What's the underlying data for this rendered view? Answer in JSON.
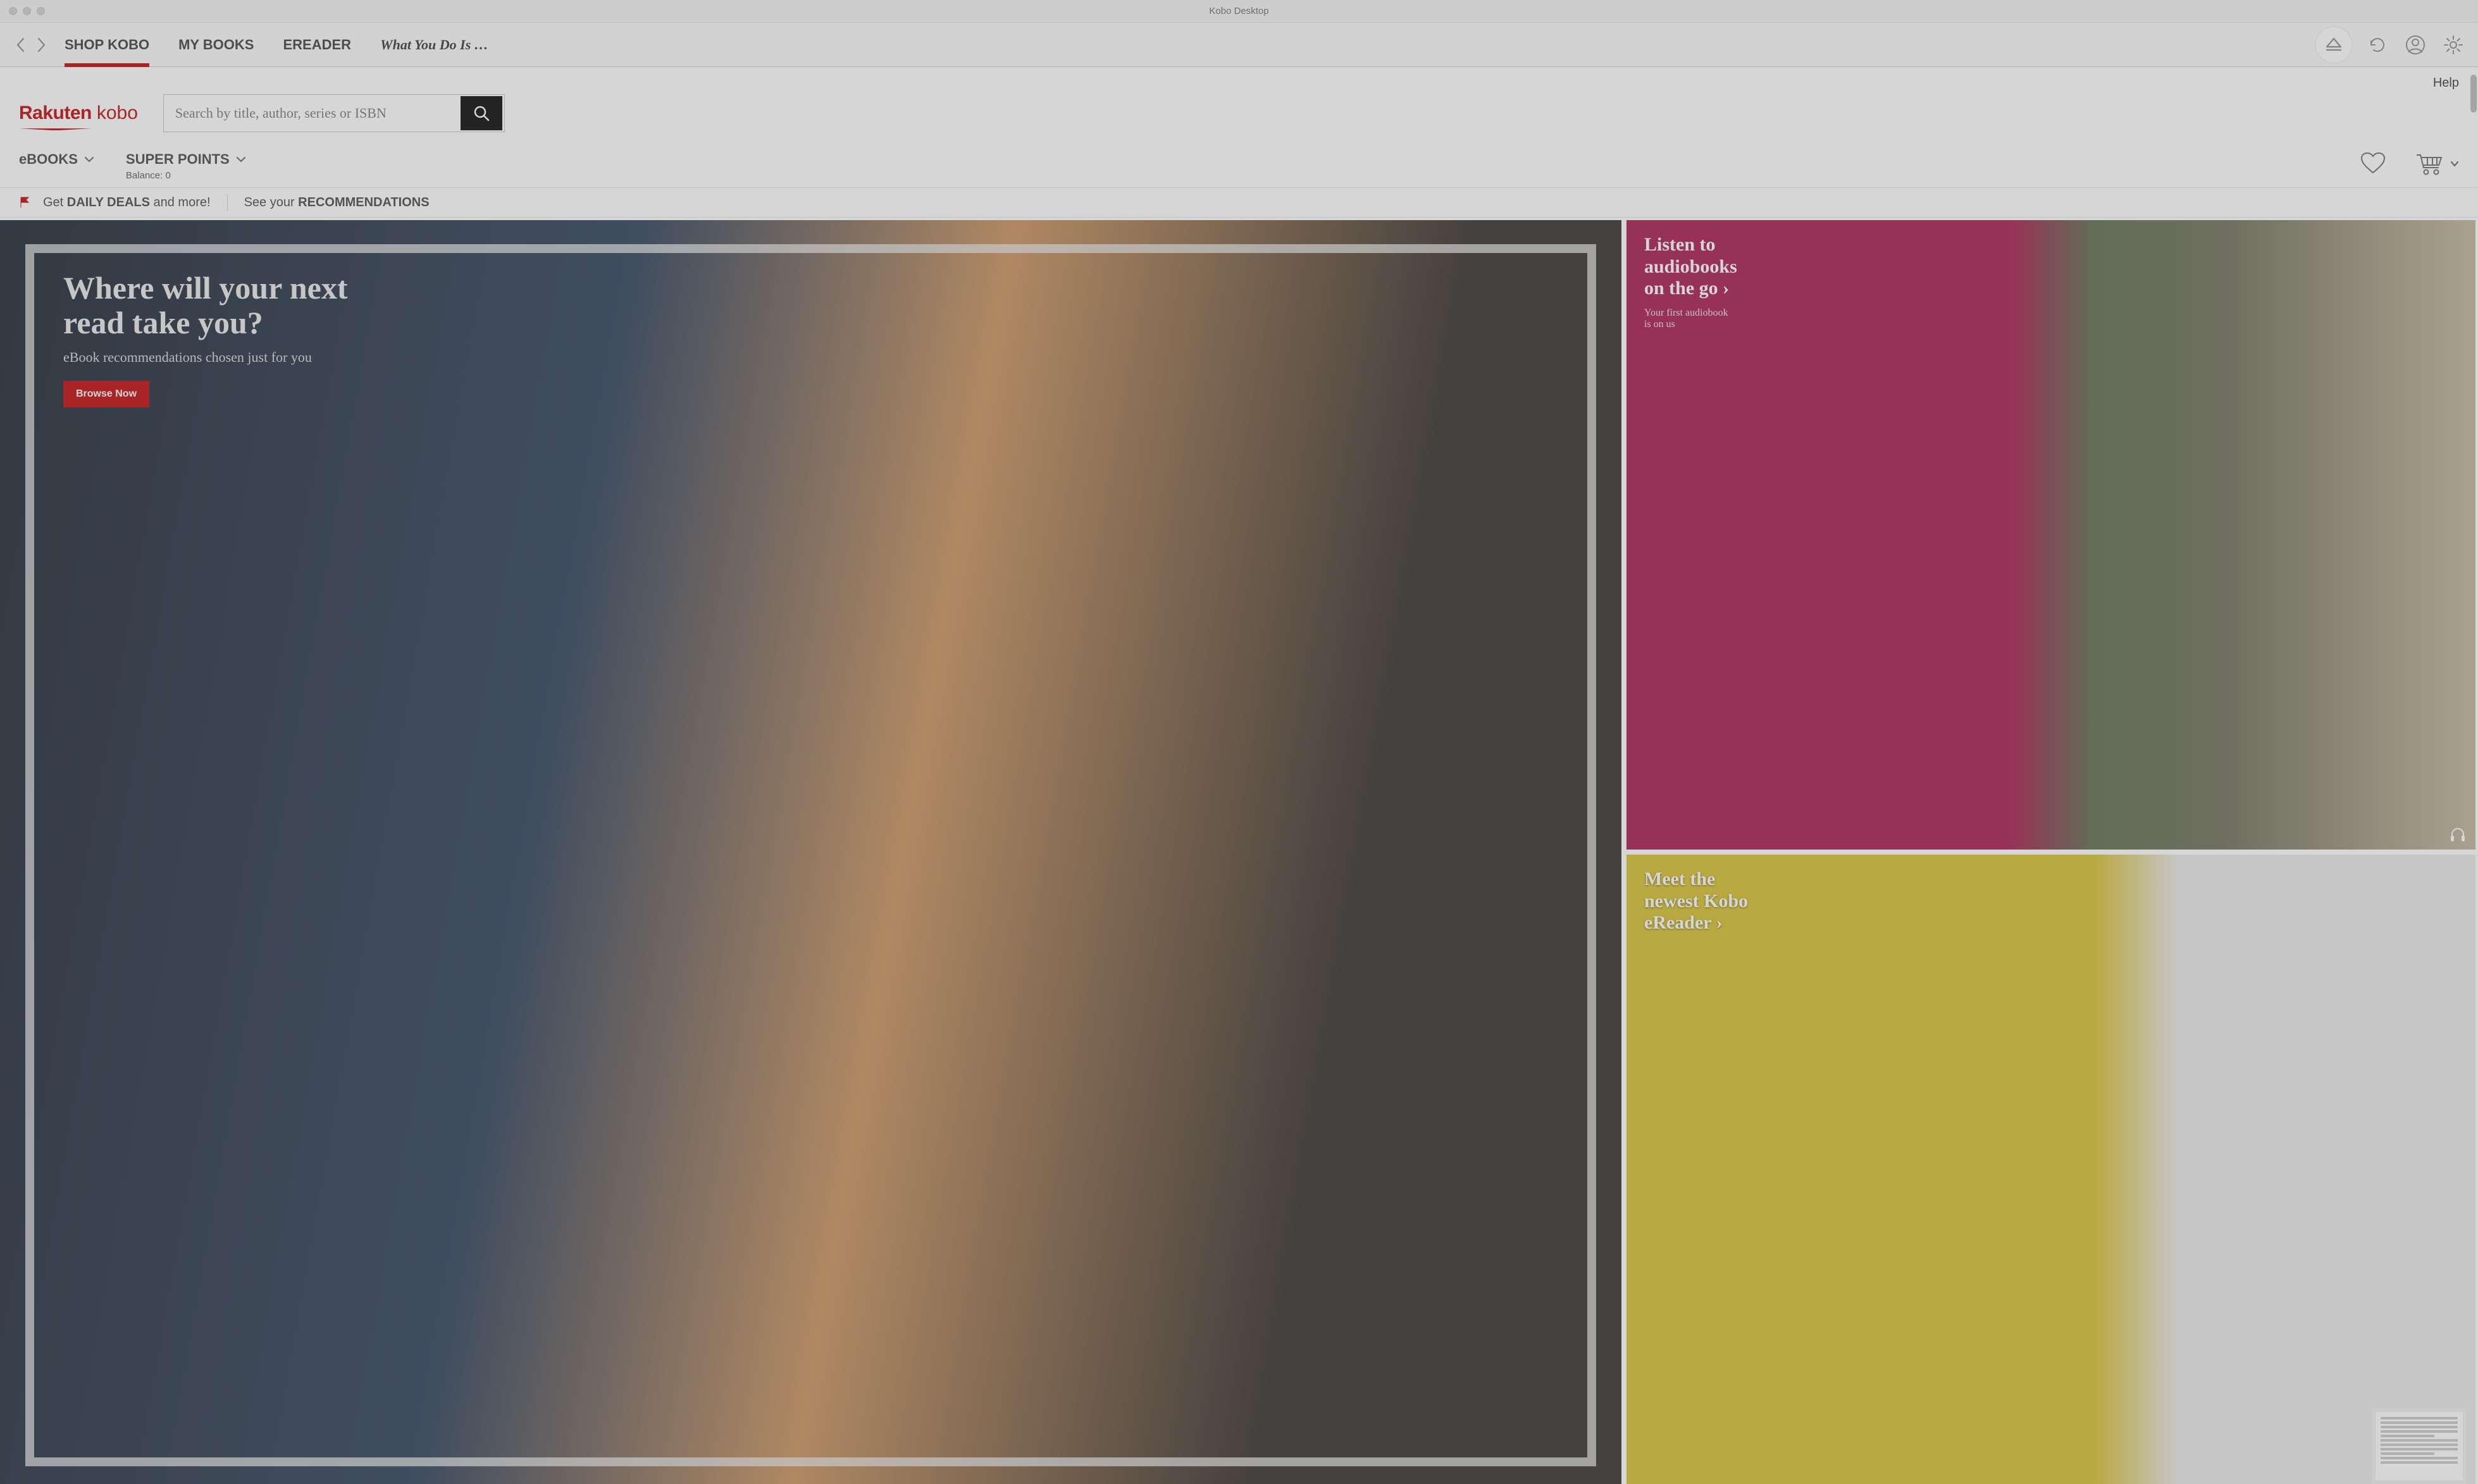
{
  "window": {
    "title": "Kobo Desktop"
  },
  "topnav": {
    "tabs": {
      "shop": "SHOP KOBO",
      "mybooks": "MY BOOKS",
      "ereader": "EREADER",
      "current_read": "What You Do Is …"
    }
  },
  "help": {
    "label": "Help"
  },
  "brand": {
    "rakuten": "Rakuten",
    "kobo": "kobo"
  },
  "search": {
    "placeholder": "Search by title, author, series or ISBN"
  },
  "subnav": {
    "ebooks": "eBOOKS",
    "superpoints": "SUPER POINTS",
    "balance_label": "Balance: 0"
  },
  "deals": {
    "get": "Get ",
    "daily_deals": "DAILY DEALS",
    "and_more": " and more!",
    "see_your": "See your ",
    "recs": "RECOMMENDATIONS"
  },
  "promo_main": {
    "headline_l1": "Where will your next",
    "headline_l2": "read take you?",
    "sub": "eBook recommendations chosen just for you",
    "cta": "Browse Now"
  },
  "promo_a": {
    "title_l1": "Listen to",
    "title_l2": "audiobooks",
    "title_l3": "on the go ›",
    "sub_l1": "Your first audiobook",
    "sub_l2": "is on us"
  },
  "promo_b": {
    "title_l1": "Meet the",
    "title_l2": "newest Kobo",
    "title_l3": "eReader ›"
  }
}
